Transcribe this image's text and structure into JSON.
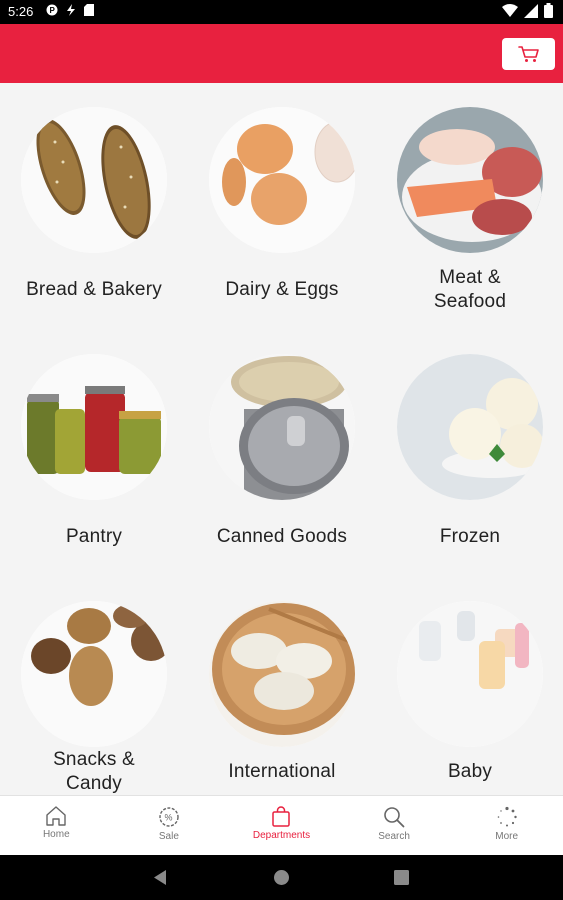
{
  "status_bar": {
    "time": "5:26",
    "left_icons": [
      "p-icon",
      "lightning-icon",
      "sd-card-icon"
    ],
    "right_icons": [
      "wifi-icon",
      "signal-icon",
      "battery-icon"
    ]
  },
  "header": {
    "color": "#e8213f",
    "cart_icon": "cart-icon"
  },
  "departments": [
    {
      "label": "Bread & Bakery",
      "image": "bread-photo"
    },
    {
      "label": "Dairy & Eggs",
      "image": "eggs-photo"
    },
    {
      "label": "Meat & Seafood",
      "label_lines": [
        "Meat &",
        "Seafood"
      ],
      "image": "meat-photo"
    },
    {
      "label": "Pantry",
      "image": "jars-photo"
    },
    {
      "label": "Canned Goods",
      "image": "cans-photo"
    },
    {
      "label": "Frozen",
      "image": "ice-cream-photo"
    },
    {
      "label": "Snacks & Candy",
      "label_lines": [
        "Snacks &",
        "Candy"
      ],
      "image": "nuts-photo"
    },
    {
      "label": "International",
      "image": "dumplings-photo"
    },
    {
      "label": "Baby",
      "image": "baby-bottles-photo"
    }
  ],
  "bottom_nav": {
    "items": [
      {
        "label": "Home",
        "icon": "home-icon",
        "active": false
      },
      {
        "label": "Sale",
        "icon": "sale-icon",
        "active": false
      },
      {
        "label": "Departments",
        "icon": "shopping-bag-icon",
        "active": true
      },
      {
        "label": "Search",
        "icon": "search-icon",
        "active": false
      },
      {
        "label": "More",
        "icon": "more-icon",
        "active": false
      }
    ]
  },
  "android_nav": [
    "back-icon",
    "home-circle-icon",
    "recents-icon"
  ]
}
